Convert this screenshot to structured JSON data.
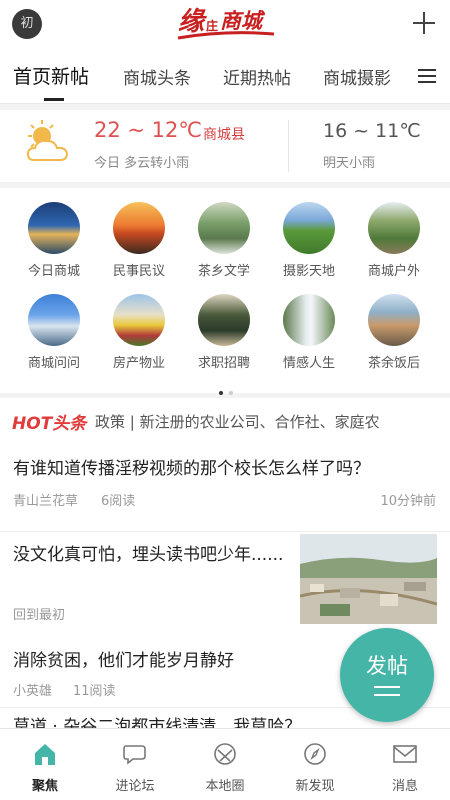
{
  "header": {
    "avatar_char": "初",
    "logo_text": "缘",
    "logo_small": "庄",
    "logo_rest": "商城"
  },
  "tabs": [
    {
      "label": "首页新帖"
    },
    {
      "label": "商城头条"
    },
    {
      "label": "近期热帖"
    },
    {
      "label": "商城摄影"
    }
  ],
  "weather": {
    "today_temp": "22 ~ 12℃",
    "county": "商城县",
    "today_desc": "今日 多云转小雨",
    "tomorrow_temp": "16 ~ 11℃",
    "tomorrow_desc": "明天小雨"
  },
  "grid": [
    {
      "label": "今日商城",
      "icon": "city-night-thumb"
    },
    {
      "label": "民事民议",
      "icon": "sunset-lake-thumb"
    },
    {
      "label": "茶乡文学",
      "icon": "mountain-stream-thumb"
    },
    {
      "label": "摄影天地",
      "icon": "green-hills-thumb"
    },
    {
      "label": "商城户外",
      "icon": "cliff-forest-thumb"
    },
    {
      "label": "商城问问",
      "icon": "blue-city-thumb"
    },
    {
      "label": "房产物业",
      "icon": "flower-field-thumb"
    },
    {
      "label": "求职招聘",
      "icon": "man-tree-thumb"
    },
    {
      "label": "情感人生",
      "icon": "waterfall-thumb"
    },
    {
      "label": "茶余饭后",
      "icon": "town-view-thumb"
    }
  ],
  "hot": {
    "logo": "HOT头条",
    "text": "政策 | 新注册的农业公司、合作社、家庭农"
  },
  "posts": [
    {
      "title": "有谁知道传播淫秽视频的那个校长怎么样了吗？",
      "author": "青山兰花草",
      "reads": "6阅读",
      "time": "10分钟前"
    },
    {
      "title": "没文化真可怕，埋头读书吧少年......",
      "author": "回到最初"
    },
    {
      "title": "消除贫困，他们才能岁月静好",
      "author": "小英雄",
      "reads": "11阅读"
    },
    {
      "title": "莫道 · 杂谷二泡都市线清清，我莫哈？"
    }
  ],
  "fab": {
    "label": "发帖"
  },
  "bottom_nav": [
    {
      "label": "聚焦",
      "icon": "home-icon"
    },
    {
      "label": "进论坛",
      "icon": "chat-icon"
    },
    {
      "label": "本地圈",
      "icon": "circle-icon"
    },
    {
      "label": "新发现",
      "icon": "compass-icon"
    },
    {
      "label": "消息",
      "icon": "mail-icon"
    }
  ],
  "colors": {
    "accent_red": "#e05050",
    "fab_teal": "#45b5a8"
  }
}
